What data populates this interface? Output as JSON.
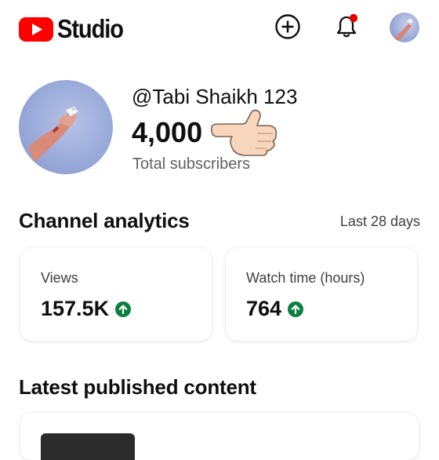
{
  "app": {
    "logo_text": "Studio",
    "brand_color": "#ff0000"
  },
  "topbar": {
    "icons": [
      "create-icon",
      "notifications-bell-icon",
      "account-avatar"
    ],
    "notification_dot_color": "#e60000"
  },
  "channel": {
    "handle": "@Tabi Shaikh 123",
    "subscribers": "4,000",
    "subscribers_label": "Total subscribers",
    "emoji": "backhand-index-pointing-left"
  },
  "analytics": {
    "title": "Channel analytics",
    "range": "Last 28 days",
    "cards": [
      {
        "label": "Views",
        "value": "157.5K",
        "trend": "up"
      },
      {
        "label": "Watch time (hours)",
        "value": "764",
        "trend": "up"
      }
    ],
    "trend_color": "#0b8043"
  },
  "latest": {
    "title": "Latest published content"
  }
}
